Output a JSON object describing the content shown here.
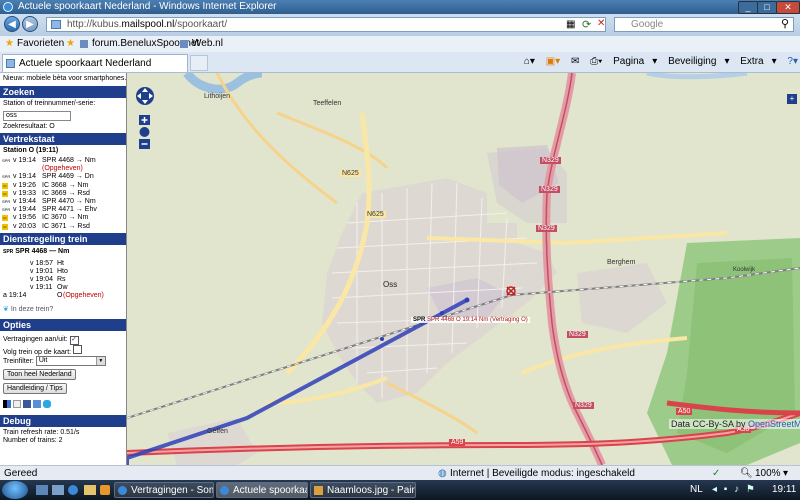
{
  "window": {
    "title": "Actuele spoorkaart Nederland - Windows Internet Explorer"
  },
  "address": {
    "prefix": "http://kubus.",
    "host": "mailspool.nl",
    "path": "/spoorkaart/"
  },
  "search": {
    "placeholder": "Google"
  },
  "favorites": {
    "label": "Favorieten",
    "links": [
      "forum.BeneluxSpoor.net",
      "Web.nl"
    ]
  },
  "tab": {
    "title": "Actuele spoorkaart Nederland"
  },
  "commands": [
    "Pagina",
    "Beveiliging",
    "Extra"
  ],
  "sidebar": {
    "intro": "Nieuw: mobiele bèta voor smartphones.",
    "zoeken": {
      "header": "Zoeken",
      "label": "Station of treinnummer/-serie:",
      "value": "oss",
      "result": "Zoekresultaat: O"
    },
    "vertrekstaat": {
      "header": "Vertrekstaat",
      "station": "Station O (19:11)",
      "rows": [
        {
          "icon": "SPR",
          "time": "v 19:14",
          "train": "SPR 4468 → Nm",
          "color": "#000"
        },
        {
          "icon": "",
          "time": "",
          "train": "(Opgeheven)",
          "color": "#c00000"
        },
        {
          "icon": "SPR",
          "time": "v 19:14",
          "train": "SPR 4469 → Dn",
          "color": "#000"
        },
        {
          "icon": "IC",
          "time": "v 19:26",
          "train": "IC 3668 → Nm",
          "color": "#000"
        },
        {
          "icon": "IC",
          "time": "v 19:33",
          "train": "IC 3669 → Rsd",
          "color": "#000"
        },
        {
          "icon": "SPR",
          "time": "v 19:44",
          "train": "SPR 4470 → Nm",
          "color": "#000"
        },
        {
          "icon": "SPR",
          "time": "v 19:44",
          "train": "SPR 4471 → Ehv",
          "color": "#000"
        },
        {
          "icon": "IC",
          "time": "v 19:56",
          "train": "IC 3670 → Nm",
          "color": "#000"
        },
        {
          "icon": "IC",
          "time": "v 20:03",
          "train": "IC 3671 → Rsd",
          "color": "#000"
        }
      ]
    },
    "dienst": {
      "header": "Dienstregeling trein",
      "train_icon": "SPR",
      "train": "SPR 4468 — Nm",
      "stops": [
        {
          "time": "v 18:57",
          "station": "Ht"
        },
        {
          "time": "v 19:01",
          "station": "Hto"
        },
        {
          "time": "v 19:04",
          "station": "Rs"
        },
        {
          "time": "v 19:11",
          "station": "Ow"
        }
      ],
      "last_time": "a 19:14",
      "last_station": "O",
      "last_note": "(Opgeheven)",
      "twitter": "In deze trein?"
    },
    "opties": {
      "header": "Opties",
      "vertragingen": "Vertragingen aan/uit:",
      "volg": "Volg trein op de kaart:",
      "filter_label": "Treinfilter:",
      "filter_value": "Uit",
      "btn_toon": "Toon heel Nederland",
      "btn_handleiding": "Handleiding / Tips"
    },
    "debug": {
      "header": "Debug",
      "refresh": "Train refresh rate: 0.51/s",
      "count": "Number of trains: 2"
    }
  },
  "map": {
    "attribution_prefix": "Data CC-By-SA by ",
    "attribution_link": "OpenStreetMap",
    "town_labels": [
      "Lithoijen",
      "Teeffelen",
      "Oss",
      "Berghem",
      "Geffen",
      "Koolwijk"
    ],
    "road_labels": [
      "N329",
      "N329",
      "N329",
      "N625",
      "N625",
      "N329",
      "N329",
      "A59",
      "A50",
      "A50"
    ],
    "train_label": "SPR",
    "train_text": "SPR 4468 O 19:14 Nm (Vertraging O)",
    "accent": "#1f3e8c"
  },
  "status": {
    "left": "Gereed",
    "zone": "Internet | Beveiligde modus: ingeschakeld",
    "zoom": "100%"
  },
  "taskbar": {
    "items": [
      "Vertragingen - Som...",
      "Actuele spoorkaart ...",
      "Naamloos.jpg - Paint"
    ],
    "lang": "NL",
    "clock": "19:11"
  }
}
